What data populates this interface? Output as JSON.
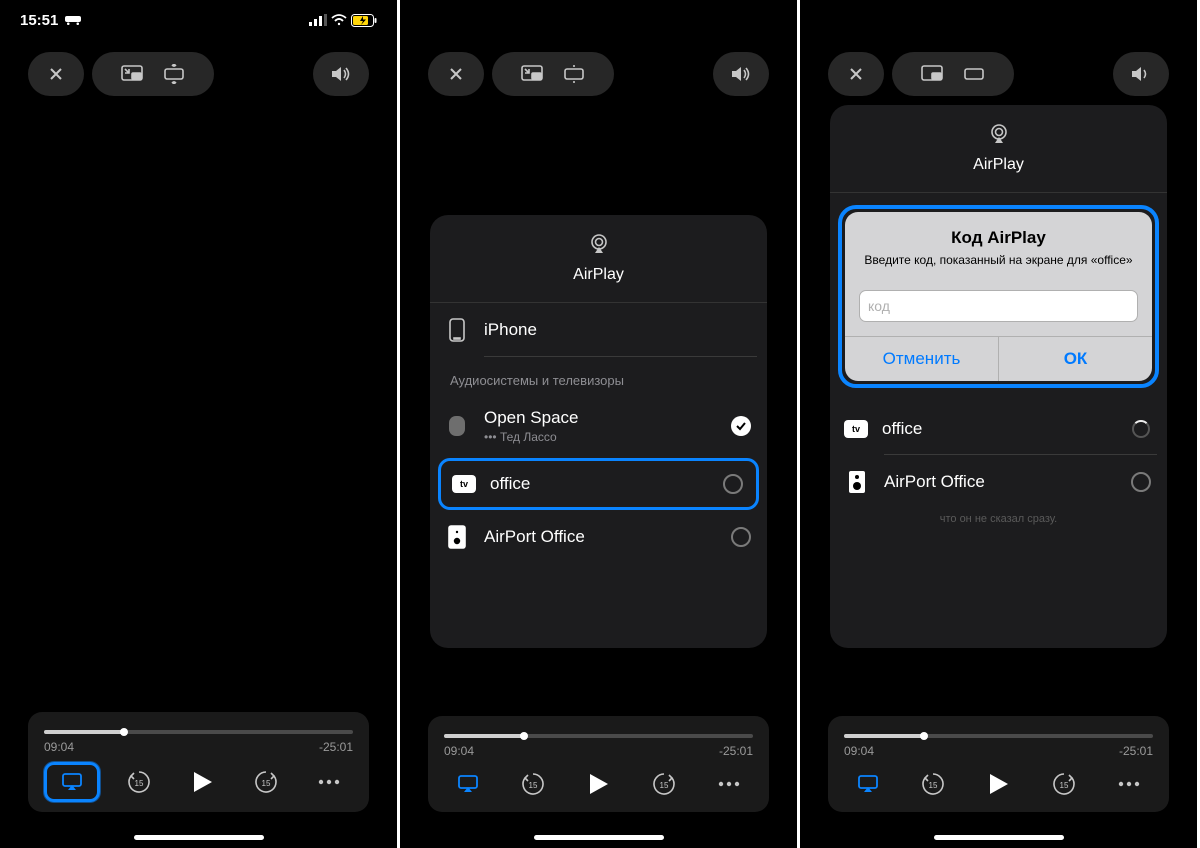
{
  "status": {
    "time": "15:51"
  },
  "player": {
    "elapsed": "09:04",
    "remaining": "-25:01"
  },
  "airplay": {
    "title": "AirPlay",
    "device_local": "iPhone",
    "section_label": "Аудиосистемы и телевизоры",
    "devices": {
      "openspace": {
        "name": "Open Space",
        "sub": "••• Тед Лассо"
      },
      "office": {
        "name": "office"
      },
      "airport": {
        "name": "AirPort Office"
      }
    }
  },
  "alert": {
    "title": "Код AirPlay",
    "message": "Введите код, показанный на экране для «office»",
    "placeholder": "код",
    "cancel": "Отменить",
    "ok": "ОК"
  },
  "caption": "что он не сказал сразу."
}
